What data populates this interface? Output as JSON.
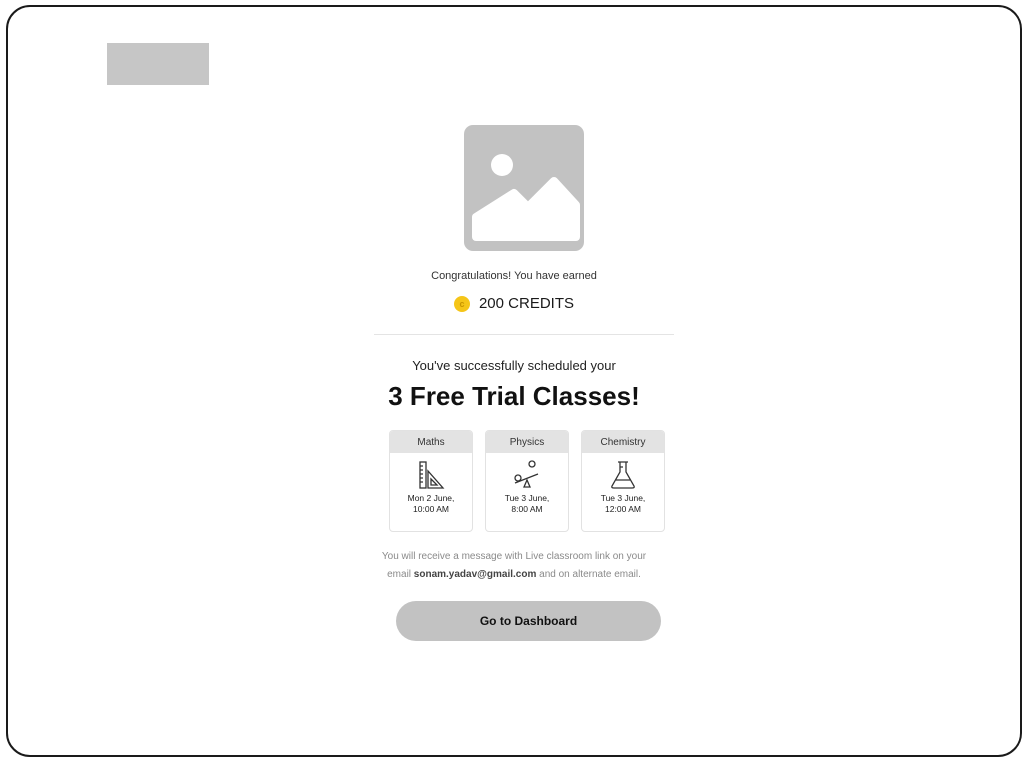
{
  "header": {
    "logo_placeholder": "logo"
  },
  "hero": {
    "image_icon": "image-placeholder-icon"
  },
  "reward": {
    "congrats_text": "Congratulations! You have earned",
    "coin_icon": "coin-icon",
    "coin_letter": "c",
    "credits_text": "200 CREDITS"
  },
  "schedule": {
    "intro_text": "You've successfully scheduled your",
    "title": "3 Free Trial Classes!",
    "classes": [
      {
        "subject": "Maths",
        "icon": "ruler-set-square-icon",
        "date": "Mon 2 June,\n10:00 AM"
      },
      {
        "subject": "Physics",
        "icon": "seesaw-icon",
        "date": "Tue 3 June,\n8:00 AM"
      },
      {
        "subject": "Chemistry",
        "icon": "flask-icon",
        "date": "Tue 3 June,\n12:00 AM"
      }
    ]
  },
  "message": {
    "line1": "You will receive a message with Live classroom link on your",
    "line2_prefix": "email",
    "email": "sonam.yadav@gmail.com",
    "line2_suffix": "and on alternate email."
  },
  "actions": {
    "dashboard_label": "Go to Dashboard"
  },
  "colors": {
    "placeholder_gray": "#c2c2c2",
    "coin_yellow": "#f5c518",
    "card_header_gray": "#e3e3e3"
  }
}
